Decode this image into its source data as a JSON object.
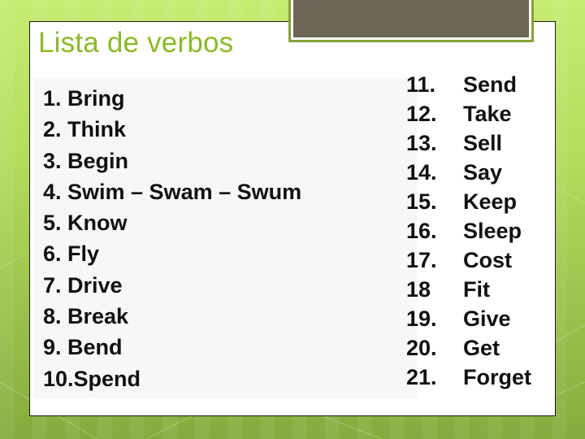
{
  "slide": {
    "title": "Lista de verbos",
    "colors": {
      "title": "#8cb82a",
      "accent_box": "#6e6656",
      "accent_border": "#86a23a",
      "background": "#b4dc5e",
      "text": "#111111"
    },
    "left_column": [
      {
        "label": "1. Bring"
      },
      {
        "label": "2. Think"
      },
      {
        "label": "3. Begin"
      },
      {
        "label": "4. Swim – Swam – Swum"
      },
      {
        "label": "5. Know"
      },
      {
        "label": "6. Fly"
      },
      {
        "label": "7. Drive"
      },
      {
        "label": "8. Break"
      },
      {
        "label": "9. Bend"
      },
      {
        "label": "10.Spend"
      }
    ],
    "right_column": [
      {
        "num": "11.",
        "verb": "Send"
      },
      {
        "num": "12.",
        "verb": "Take"
      },
      {
        "num": "13.",
        "verb": "Sell"
      },
      {
        "num": "14.",
        "verb": "Say"
      },
      {
        "num": "15.",
        "verb": "Keep"
      },
      {
        "num": "16.",
        "verb": "Sleep"
      },
      {
        "num": "17.",
        "verb": "Cost"
      },
      {
        "num": "18",
        "verb": "Fit"
      },
      {
        "num": "19.",
        "verb": "Give"
      },
      {
        "num": "20.",
        "verb": "Get"
      },
      {
        "num": "21.",
        "verb": "Forget"
      }
    ]
  }
}
